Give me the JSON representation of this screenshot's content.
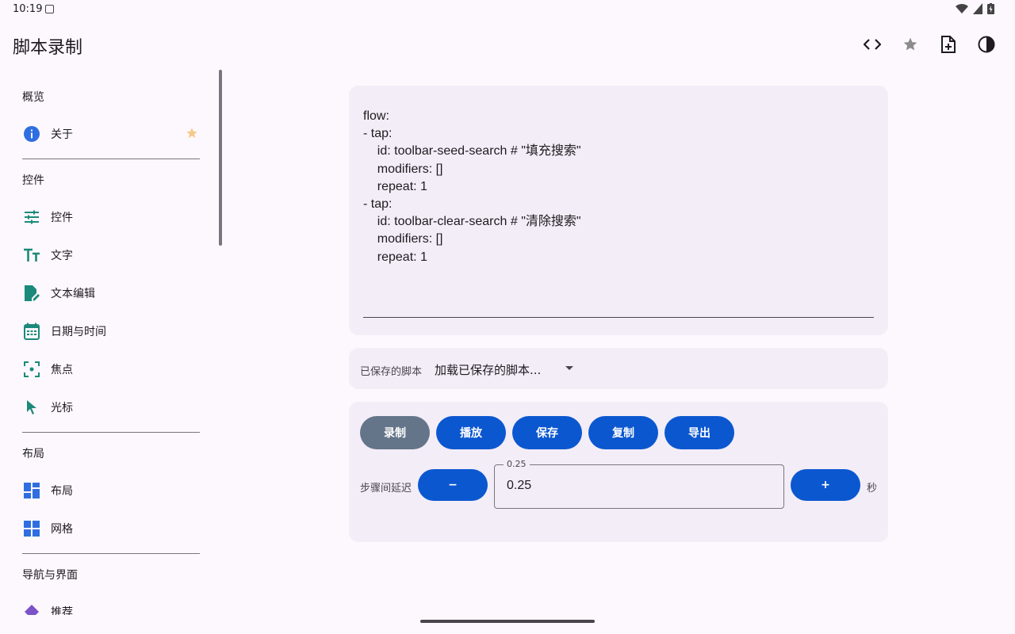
{
  "status": {
    "time": "10:19"
  },
  "app": {
    "title": "脚本录制"
  },
  "sidebar": {
    "sections": [
      {
        "title": "概览"
      },
      {
        "title": "控件"
      },
      {
        "title": "布局"
      },
      {
        "title": "导航与界面"
      }
    ],
    "items": [
      {
        "label": "关于",
        "icon": "info-icon"
      },
      {
        "label": "控件",
        "icon": "sliders-icon"
      },
      {
        "label": "文字",
        "icon": "text-icon"
      },
      {
        "label": "文本编辑",
        "icon": "edit-document-icon"
      },
      {
        "label": "日期与时间",
        "icon": "calendar-icon"
      },
      {
        "label": "焦点",
        "icon": "focus-icon"
      },
      {
        "label": "光标",
        "icon": "cursor-icon"
      },
      {
        "label": "布局",
        "icon": "dashboard-icon"
      },
      {
        "label": "网格",
        "icon": "grid-icon"
      },
      {
        "label": "推荐",
        "icon": "diamond-icon"
      }
    ]
  },
  "editor": {
    "script": "flow:\n- tap:\n    id: toolbar-seed-search # \"填充搜索\"\n    modifiers: []\n    repeat: 1\n- tap:\n    id: toolbar-clear-search # \"清除搜索\"\n    modifiers: []\n    repeat: 1"
  },
  "saved": {
    "label": "已保存的脚本",
    "value": "加载已保存的脚本..."
  },
  "buttons": {
    "record": "录制",
    "play": "播放",
    "save": "保存",
    "copy": "复制",
    "export": "导出",
    "minus": "−",
    "plus": "+"
  },
  "delay": {
    "label": "步骤间延迟",
    "floating_label": "0.25",
    "value": "0.25",
    "unit": "秒"
  },
  "colors": {
    "primary": "#0b57d0",
    "record": "#657589",
    "nav_icon": "#1b8a7a",
    "card": "#f3edf7"
  }
}
